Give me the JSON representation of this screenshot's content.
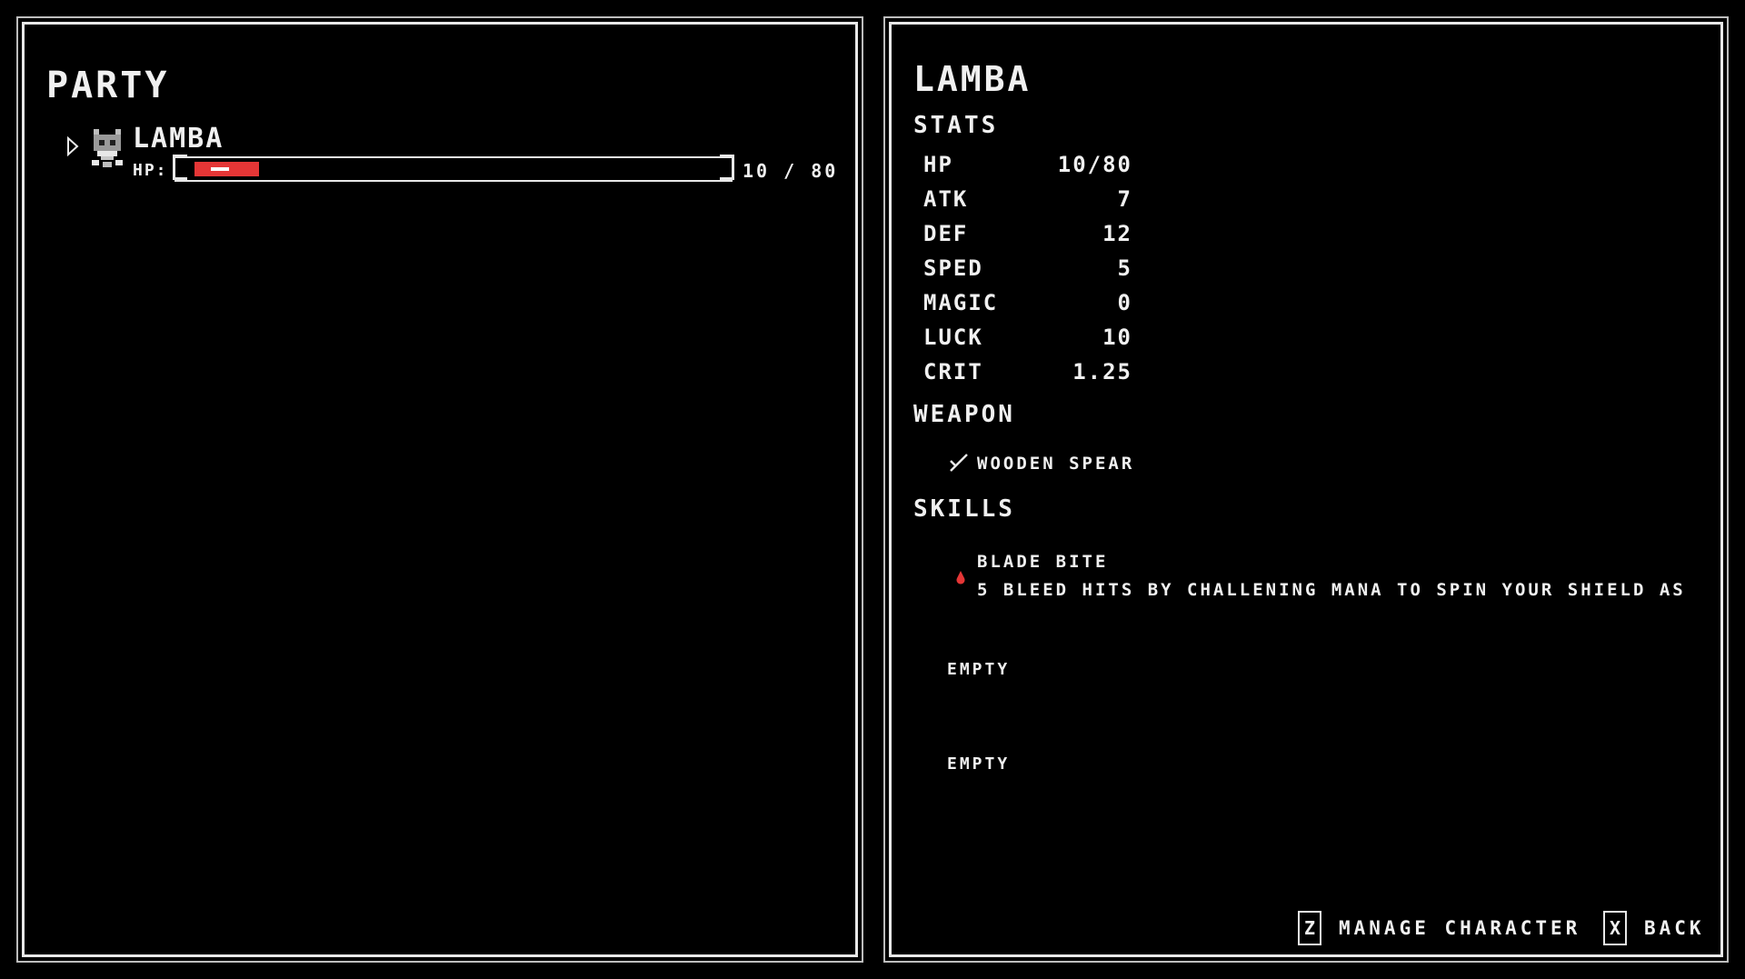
{
  "party": {
    "title": "PARTY",
    "members": [
      {
        "name": "LAMBA",
        "hp_label": "HP:",
        "hp_text": "10 / 80",
        "hp_fraction": 0.125,
        "icon": "cat-skull-sprite-icon",
        "selected": true
      }
    ]
  },
  "detail": {
    "name": "LAMBA",
    "stats_title": "STATS",
    "stats": [
      {
        "label": "HP",
        "value": "10/80"
      },
      {
        "label": "ATK",
        "value": "7"
      },
      {
        "label": "DEF",
        "value": "12"
      },
      {
        "label": "SPED",
        "value": "5"
      },
      {
        "label": "MAGIC",
        "value": "0"
      },
      {
        "label": "LUCK",
        "value": "10"
      },
      {
        "label": "CRIT",
        "value": "1.25"
      }
    ],
    "weapon_title": "WEAPON",
    "weapon": {
      "name": "WOODEN SPEAR",
      "icon": "spear-icon"
    },
    "skills_title": "SKILLS",
    "skills": [
      {
        "name": "BLADE BITE",
        "description": "5 BLEED HITS BY CHALLENING MANA TO SPIN YOUR SHIELD AS",
        "icon": "blood-drop-icon"
      },
      {
        "name": "EMPTY"
      },
      {
        "name": "EMPTY"
      }
    ]
  },
  "controls": [
    {
      "key": "Z",
      "label": "MANAGE CHARACTER"
    },
    {
      "key": "X",
      "label": "BACK"
    }
  ],
  "colors": {
    "hp_fill": "#e53636",
    "border": "#e8e8e8",
    "background": "#000000",
    "text": "#f0f0f0"
  }
}
